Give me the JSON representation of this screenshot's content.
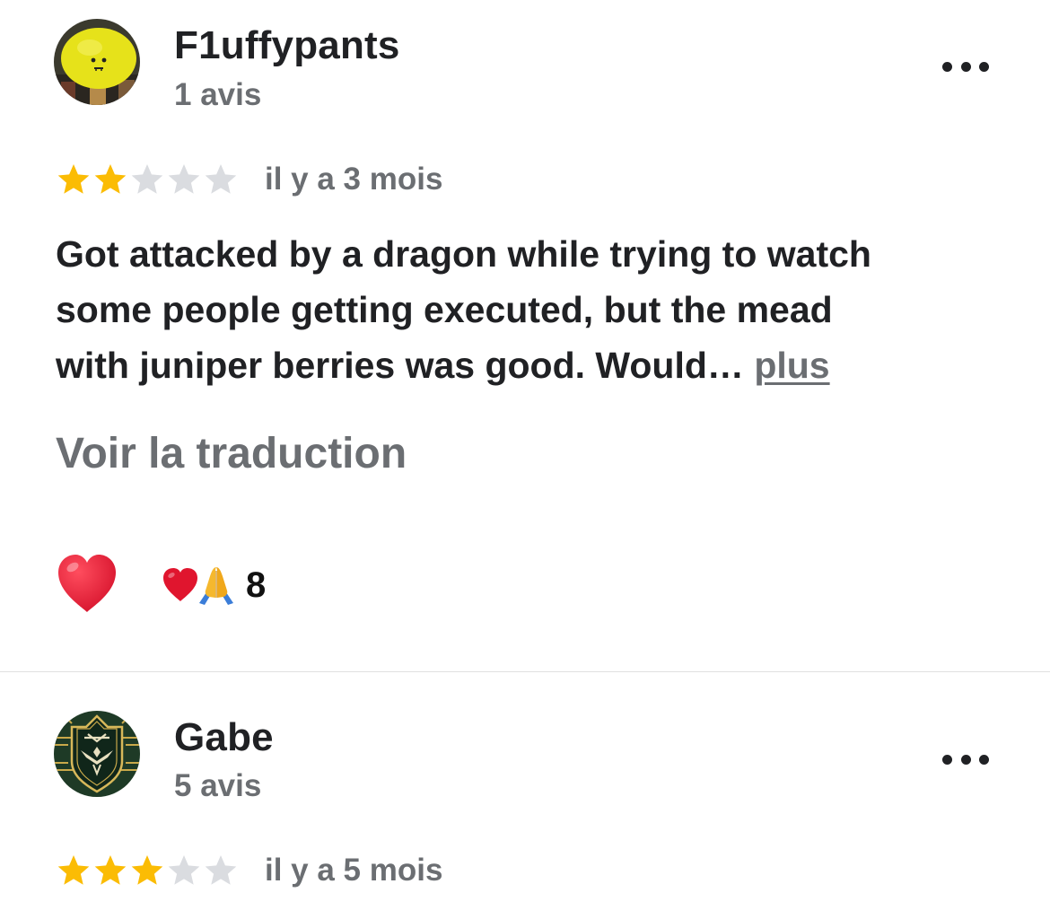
{
  "colors": {
    "star_filled": "#fbbc04",
    "star_empty": "#dadce0",
    "text_primary": "#202124",
    "text_secondary": "#6b6e72",
    "heart": "#e0152e",
    "divider": "#e0e0e0"
  },
  "reviews": [
    {
      "author": {
        "name": "F1uffypants",
        "review_count": "1 avis",
        "avatar_icon": "lemon-avatar"
      },
      "more_options_icon": "more-horizontal-icon",
      "rating": 2,
      "rating_max": 5,
      "time_ago": "il y a 3 mois",
      "text_lines": [
        "Got attacked by a dragon while trying to watch",
        "some people getting executed, but the mead",
        "with juniper berries was good. Would… "
      ],
      "more_label": "plus",
      "translate_label": "Voir la traduction",
      "react_icon": "heart-icon",
      "reaction_icons": [
        "heart-icon",
        "praying-hands-icon"
      ],
      "reaction_count": "8"
    },
    {
      "author": {
        "name": "Gabe",
        "review_count": "5 avis",
        "avatar_icon": "hylian-crest-avatar"
      },
      "more_options_icon": "more-horizontal-icon",
      "rating": 3,
      "rating_max": 5,
      "time_ago": "il y a 5 mois"
    }
  ]
}
